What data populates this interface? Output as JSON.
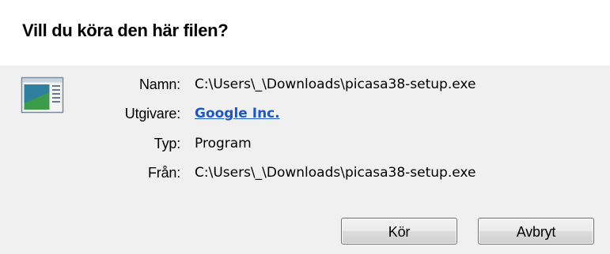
{
  "dialog": {
    "title": "Vill du köra den här filen?"
  },
  "file_info": {
    "name_label": "Namn:",
    "name_value": "C:\\Users\\_\\Downloads\\picasa38-setup.exe",
    "publisher_label": "Utgivare:",
    "publisher_value": "Google Inc.",
    "type_label": "Typ:",
    "type_value": "Program",
    "from_label": "Från:",
    "from_value": "C:\\Users\\_\\Downloads\\picasa38-setup.exe"
  },
  "buttons": {
    "run_label": "Kör",
    "cancel_label": "Avbryt"
  },
  "icons": {
    "file_icon": "application-window-icon"
  },
  "colors": {
    "link": "#1b59c7",
    "body_background": "#f0f0f0"
  }
}
